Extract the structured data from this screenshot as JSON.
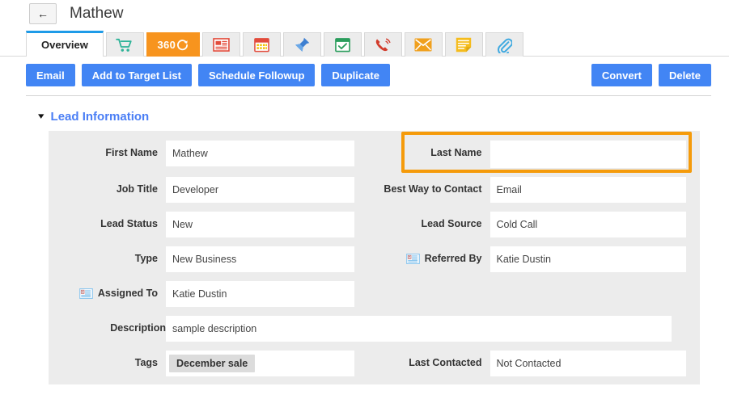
{
  "header": {
    "back_icon": "back-arrow-icon",
    "back_label": "←",
    "record_title": "Mathew"
  },
  "tabs": [
    {
      "id": "overview",
      "label": "Overview",
      "icon": "",
      "active": true
    },
    {
      "id": "cart",
      "label": "Shopping Cart",
      "icon": "shopping-cart-icon",
      "active": false
    },
    {
      "id": "360",
      "label": "360",
      "icon": "refresh-circle-icon",
      "active": false
    },
    {
      "id": "news",
      "label": "News",
      "icon": "newspaper-icon",
      "active": false
    },
    {
      "id": "calendar",
      "label": "Calendar",
      "icon": "calendar-icon",
      "active": false
    },
    {
      "id": "pin",
      "label": "Pinned",
      "icon": "pushpin-icon",
      "active": false
    },
    {
      "id": "tasks",
      "label": "Tasks",
      "icon": "checked-calendar-icon",
      "active": false
    },
    {
      "id": "calls",
      "label": "Calls",
      "icon": "phone-ringing-icon",
      "active": false
    },
    {
      "id": "emails",
      "label": "Emails",
      "icon": "envelope-icon",
      "active": false
    },
    {
      "id": "notes",
      "label": "Notes",
      "icon": "note-icon",
      "active": false
    },
    {
      "id": "attach",
      "label": "Attachments",
      "icon": "paperclip-icon",
      "active": false
    }
  ],
  "actions": {
    "left": [
      {
        "id": "email",
        "label": "Email"
      },
      {
        "id": "add-target-list",
        "label": "Add to Target List"
      },
      {
        "id": "schedule",
        "label": "Schedule Followup"
      },
      {
        "id": "duplicate",
        "label": "Duplicate"
      }
    ],
    "right": [
      {
        "id": "convert",
        "label": "Convert"
      },
      {
        "id": "delete",
        "label": "Delete"
      }
    ]
  },
  "section": {
    "chevron": "▾",
    "title": "Lead Information"
  },
  "fields": {
    "first_name": {
      "label": "First Name",
      "value": "Mathew"
    },
    "last_name": {
      "label": "Last Name",
      "value": ""
    },
    "job_title": {
      "label": "Job Title",
      "value": "Developer"
    },
    "best_way": {
      "label": "Best Way to Contact",
      "value": "Email"
    },
    "lead_status": {
      "label": "Lead Status",
      "value": "New"
    },
    "lead_source": {
      "label": "Lead Source",
      "value": "Cold Call"
    },
    "type": {
      "label": "Type",
      "value": "New Business"
    },
    "referred_by": {
      "label": "Referred By",
      "value": "Katie Dustin",
      "icon": "contact-card-icon"
    },
    "assigned_to": {
      "label": "Assigned To",
      "value": "Katie Dustin",
      "icon": "contact-card-icon"
    },
    "description": {
      "label": "Description",
      "value": "sample description"
    },
    "tags": {
      "label": "Tags",
      "value": "December sale"
    },
    "last_contacted": {
      "label": "Last Contacted",
      "value": "Not Contacted"
    }
  },
  "colors": {
    "accent_blue": "#4285f4",
    "tab_active_border": "#1e9be8",
    "tab_360_bg": "#f7941e",
    "highlight_orange": "#f59b0b",
    "panel_bg": "#ececec",
    "section_title": "#4a7ef5"
  }
}
